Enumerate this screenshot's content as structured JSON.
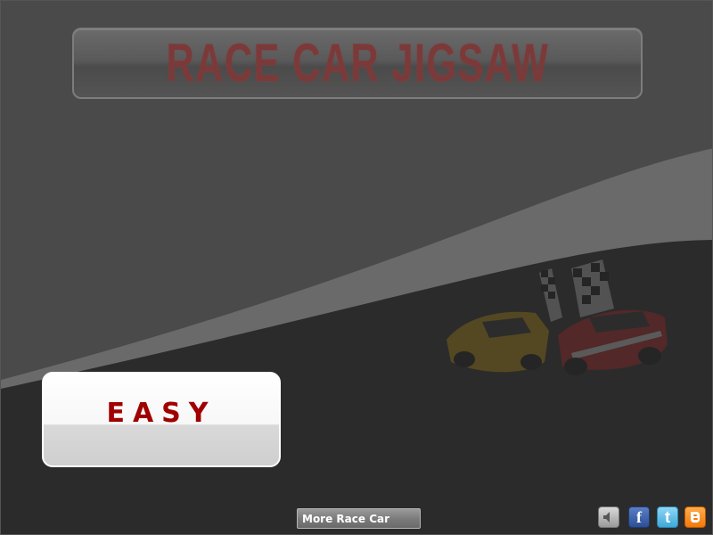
{
  "title": "RACE CAR JIGSAW",
  "difficulty": {
    "label": "EASY"
  },
  "footer": {
    "more_label": "More Race Car"
  },
  "icons": {
    "sound": "speaker-icon",
    "facebook": "facebook-icon",
    "twitter": "twitter-icon",
    "blogger": "blogger-icon"
  },
  "icon_glyphs": {
    "facebook": "f",
    "twitter": "t"
  },
  "colors": {
    "background": "#2b2b2b",
    "title_text": "#7b3a3a",
    "easy_text": "#a00000"
  }
}
